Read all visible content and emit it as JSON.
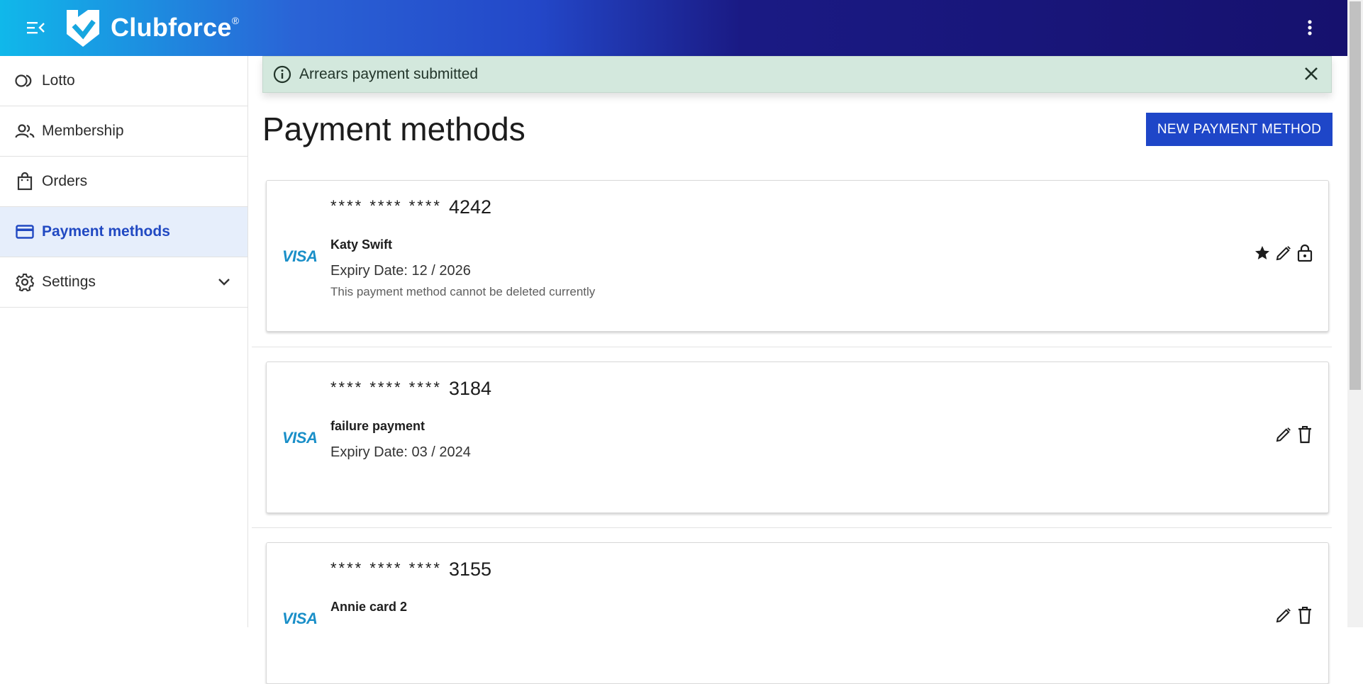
{
  "header": {
    "brand": "Clubforce",
    "brand_mark": "®",
    "menu_icon": "menu-collapse-icon",
    "more_icon": "more-vertical-icon",
    "colors": {
      "gradient_start": "#10b8ea",
      "gradient_mid": "#2347c8",
      "gradient_end": "#16116e"
    }
  },
  "sidebar": {
    "items": [
      {
        "label": "Lotto",
        "icon": "lotto-icon"
      },
      {
        "label": "Membership",
        "icon": "people-icon"
      },
      {
        "label": "Orders",
        "icon": "shopping-bag-icon"
      },
      {
        "label": "Payment methods",
        "icon": "credit-card-icon",
        "active": true
      },
      {
        "label": "Settings",
        "icon": "gear-icon",
        "expandable": true
      }
    ],
    "active_color": "#2149c2"
  },
  "alert": {
    "message": "Arrears payment submitted",
    "background": "#d3e8dd"
  },
  "main": {
    "title": "Payment methods",
    "new_button_label": "NEW PAYMENT METHOD",
    "accent": "#1e46c8",
    "cards": [
      {
        "brand": "VISA",
        "mask": "**** **** ****",
        "last4": "4242",
        "name": "Katy Swift",
        "expiry": "Expiry Date: 12 / 2026",
        "note": "This payment method cannot be deleted currently",
        "actions": [
          "star-icon",
          "edit-icon",
          "lock-icon"
        ]
      },
      {
        "brand": "VISA",
        "mask": "**** **** ****",
        "last4": "3184",
        "name": "failure payment",
        "expiry": "Expiry Date: 03 / 2024",
        "note": "",
        "actions": [
          "edit-icon",
          "delete-icon"
        ]
      },
      {
        "brand": "VISA",
        "mask": "**** **** ****",
        "last4": "3155",
        "name": "Annie card 2",
        "expiry": "",
        "note": "",
        "actions": [
          "edit-icon",
          "delete-icon"
        ]
      }
    ]
  }
}
